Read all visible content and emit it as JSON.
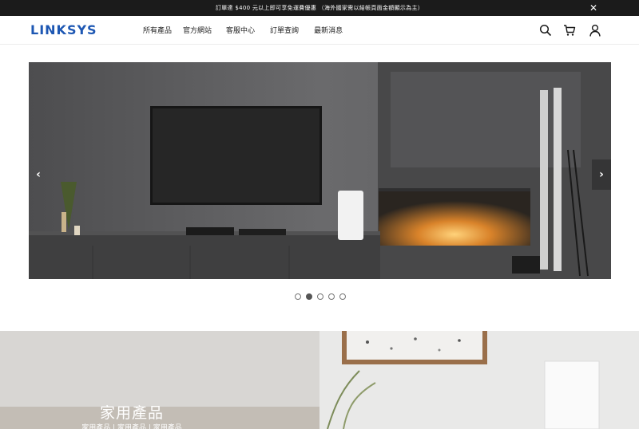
{
  "announcement": {
    "text": "訂單達 $400 元以上即可享免運費優惠 （海外國家需以結帳頁面金額顯示為主）",
    "close_icon": "close-icon"
  },
  "header": {
    "logo": "LINKSYS",
    "nav": [
      "所有產品",
      "官方網站",
      "客服中心",
      "訂單查詢",
      "最新消息"
    ],
    "icons": [
      "search-icon",
      "cart-icon",
      "account-icon"
    ],
    "brand_color": "#1d57b3"
  },
  "hero": {
    "arrows": [
      "chevron-left-icon",
      "chevron-right-icon"
    ],
    "slides": 5,
    "active_slide": 2
  },
  "tiles": {
    "home_title": "家用產品",
    "home_sub": "家用產品 | 家用產品 | 家用產品"
  }
}
